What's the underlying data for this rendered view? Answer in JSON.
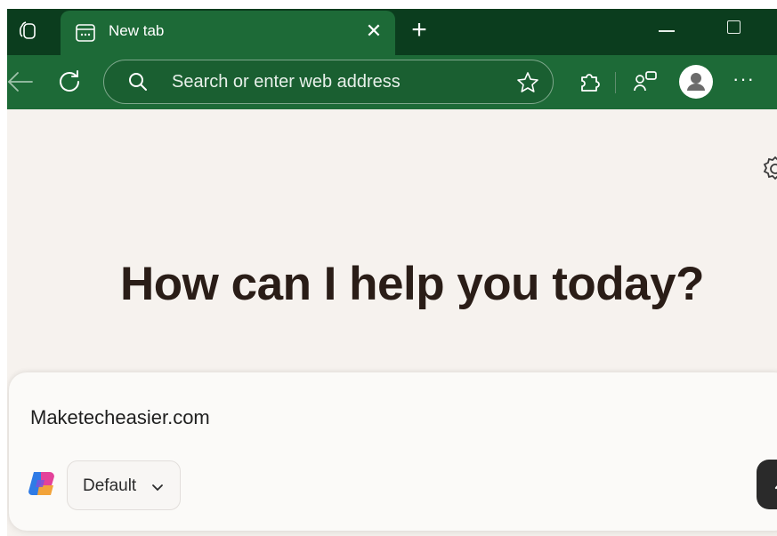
{
  "tabstrip": {
    "workspace_icon": "workspaces-icon",
    "active_tab": {
      "title": "New tab",
      "favicon": "new-tab-page-icon",
      "close_glyph": "✕"
    },
    "new_tab_glyph": "+"
  },
  "toolbar": {
    "omnibox": {
      "placeholder": "Search or enter web address"
    },
    "more_glyph": "···"
  },
  "page": {
    "headline": "How can I help you today?",
    "composer": {
      "input_value": "Maketecheasier.com",
      "mode_label": "Default"
    }
  },
  "colors": {
    "tabstrip_bg": "#0b3d1e",
    "toolbar_bg": "#1d6a37",
    "page_bg": "#f6f2ee",
    "headline": "#2a1d17"
  }
}
